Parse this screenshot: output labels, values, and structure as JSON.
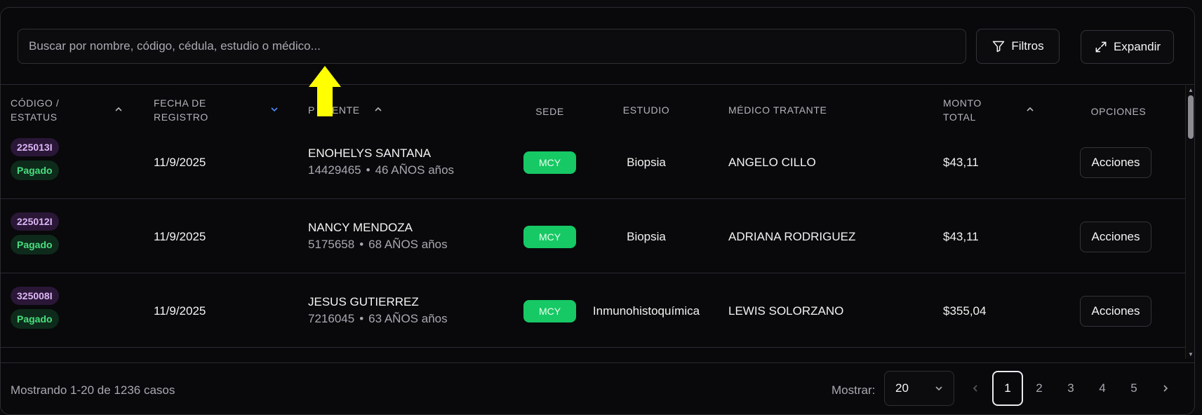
{
  "search": {
    "placeholder": "Buscar por nombre, código, cédula, estudio o médico..."
  },
  "toolbar": {
    "filters_label": "Filtros",
    "expand_label": "Expandir"
  },
  "columns": {
    "code_status": [
      "CÓDIGO /",
      "ESTATUS"
    ],
    "date": [
      "FECHA DE",
      "REGISTRO"
    ],
    "patient_prefix": "P",
    "patient_suffix": "ENTE",
    "sede": "SEDE",
    "study": "ESTUDIO",
    "doctor": "MÉDICO TRATANTE",
    "amount": [
      "MONTO",
      "TOTAL"
    ],
    "options": "OPCIONES"
  },
  "rows": [
    {
      "code": "225013I",
      "status": "Pagado",
      "date": "11/9/2025",
      "patient": "ENOHELYS SANTANA",
      "id": "14429465",
      "age": "46 AÑOS años",
      "sede": "MCY",
      "study": "Biopsia",
      "doctor": "ANGELO CILLO",
      "amount": "$43,11",
      "action": "Acciones"
    },
    {
      "code": "225012I",
      "status": "Pagado",
      "date": "11/9/2025",
      "patient": "NANCY MENDOZA",
      "id": "5175658",
      "age": "68 AÑOS años",
      "sede": "MCY",
      "study": "Biopsia",
      "doctor": "ADRIANA RODRIGUEZ",
      "amount": "$43,11",
      "action": "Acciones"
    },
    {
      "code": "325008I",
      "status": "Pagado",
      "date": "11/9/2025",
      "patient": "JESUS GUTIERREZ",
      "id": "7216045",
      "age": "63 AÑOS años",
      "sede": "MCY",
      "study": "Inmunohistoquímica",
      "doctor": "LEWIS SOLORZANO",
      "amount": "$355,04",
      "action": "Acciones"
    }
  ],
  "footer": {
    "showing": "Mostrando 1-20 de 1236 casos",
    "show_label": "Mostrar:",
    "page_size": "20",
    "pages": [
      "1",
      "2",
      "3",
      "4",
      "5"
    ],
    "current_page": "1"
  },
  "colors": {
    "background": "#09090b",
    "code_badge": "#2a1636",
    "status_badge": "#0e2a1a",
    "sede_badge": "#17c964",
    "highlight_arrow": "#ffff00"
  },
  "icons": [
    "filter-icon",
    "expand-icon",
    "sort-up-icon",
    "sort-down-icon",
    "chevron-down-icon",
    "chevron-left-icon",
    "chevron-right-icon"
  ]
}
